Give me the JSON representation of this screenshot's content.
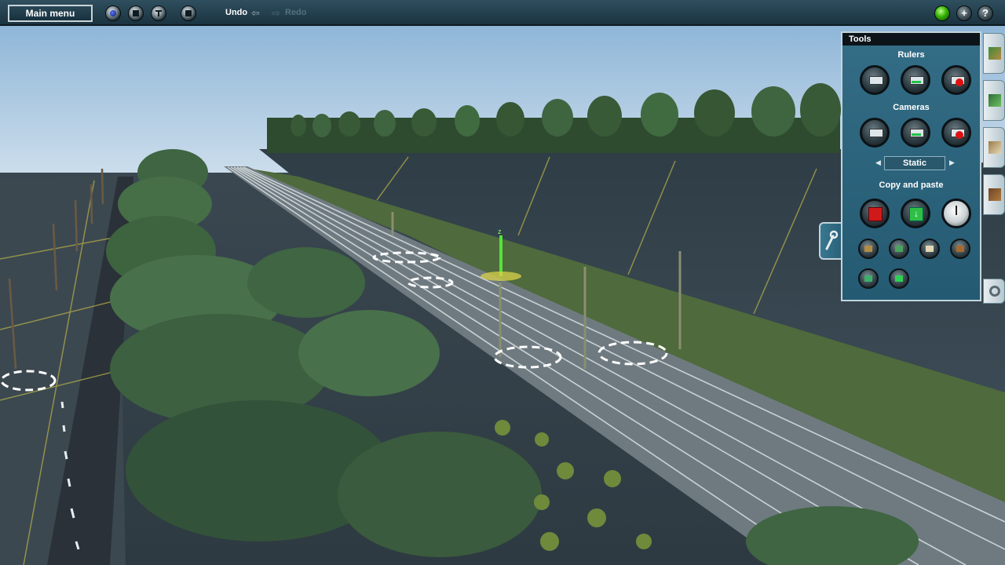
{
  "toolbar": {
    "main_menu_label": "Main menu",
    "undo_label": "Undo",
    "redo_label": "Redo"
  },
  "tools_panel": {
    "title": "Tools",
    "rulers_title": "Rulers",
    "cameras_title": "Cameras",
    "camera_mode": "Static",
    "copy_paste_title": "Copy and paste"
  },
  "colors": {
    "panel_bg": "#2b6279",
    "toolbar_bg": "#233f4d",
    "sky": "#b9d7ec",
    "grass": "#5f7d43",
    "track": "#8f9a9c"
  }
}
